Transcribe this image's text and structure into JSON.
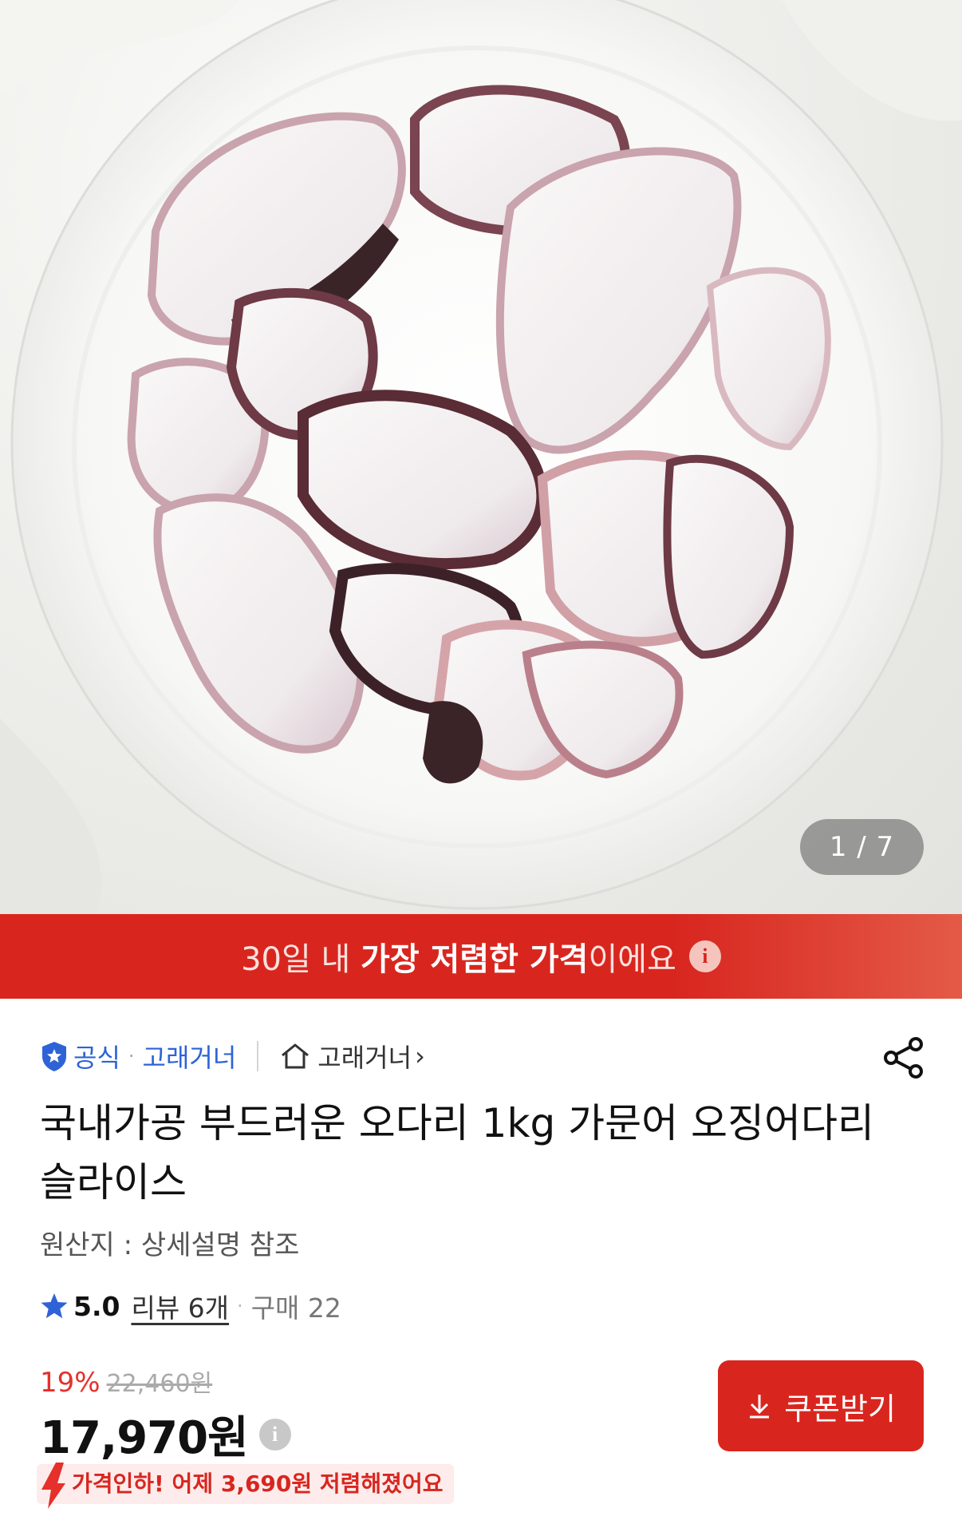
{
  "gallery": {
    "counter": "1 / 7"
  },
  "banner": {
    "pre": "30일 내 ",
    "bold": "가장 저렴한 가격",
    "post": "이에요",
    "info_glyph": "i"
  },
  "seller": {
    "badge": "공식",
    "brand": "고래거너",
    "store": "고래거너",
    "store_chevron": "›"
  },
  "product": {
    "title": "국내가공 부드러운 오다리 1kg 가문어 오징어다리 슬라이스",
    "origin": "원산지 : 상세설명 참조",
    "rating": "5.0",
    "reviews": "리뷰 6개",
    "purchases": "구매 22"
  },
  "pricing": {
    "discount_pct": "19%",
    "original_price": "22,460원",
    "price": "17,970원",
    "info_glyph": "i",
    "price_drop": "가격인하! 어제 3,690원 저렴해졌어요"
  },
  "actions": {
    "coupon_label": "쿠폰받기"
  },
  "icons": {
    "shield": "shield-icon",
    "home": "home-icon",
    "share": "share-icon",
    "star": "star-icon",
    "download": "download-icon",
    "arrow_down": "arrow-down-icon"
  },
  "colors": {
    "accent_red": "#d8261f",
    "official_blue": "#2e63d6",
    "star_blue": "#2e63d6"
  }
}
